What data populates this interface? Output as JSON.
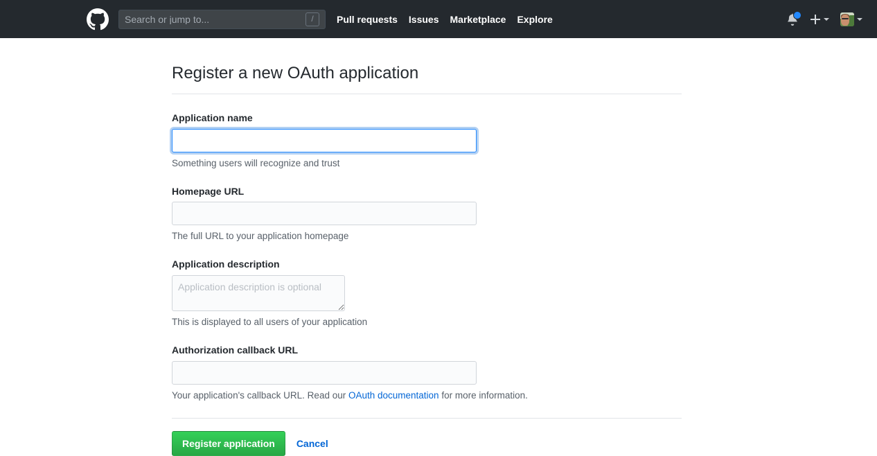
{
  "header": {
    "logo_icon": "github-mark-icon",
    "search": {
      "placeholder": "Search or jump to...",
      "value": "",
      "shortcut_badge": "/"
    },
    "nav": [
      {
        "label": "Pull requests"
      },
      {
        "label": "Issues"
      },
      {
        "label": "Marketplace"
      },
      {
        "label": "Explore"
      }
    ],
    "notifications": {
      "icon": "bell-icon",
      "has_unread_dot": true,
      "dot_color": "#2188ff"
    },
    "create_new": {
      "icon": "plus-icon",
      "caret": "chevron-down-icon"
    },
    "profile": {
      "icon": "avatar",
      "caret": "chevron-down-icon"
    },
    "background_color": "#24292e"
  },
  "main": {
    "title": "Register a new OAuth application",
    "fields": [
      {
        "id": "application-name",
        "label": "Application name",
        "value": "",
        "placeholder": "",
        "help": "Something users will recognize and trust",
        "focused": true,
        "type": "text"
      },
      {
        "id": "homepage-url",
        "label": "Homepage URL",
        "value": "",
        "placeholder": "",
        "help": "The full URL to your application homepage",
        "focused": false,
        "type": "text"
      },
      {
        "id": "application-description",
        "label": "Application description",
        "value": "",
        "placeholder": "Application description is optional",
        "help": "This is displayed to all users of your application",
        "focused": false,
        "type": "textarea"
      },
      {
        "id": "authorization-callback-url",
        "label": "Authorization callback URL",
        "value": "",
        "placeholder": "",
        "help_before": "Your application's callback URL. Read our ",
        "help_link": "OAuth documentation",
        "help_after": " for more information.",
        "focused": false,
        "type": "text"
      }
    ],
    "actions": {
      "submit_label": "Register application",
      "cancel_label": "Cancel",
      "submit_color": "#2cbe4e",
      "link_color": "#0366d6"
    }
  }
}
